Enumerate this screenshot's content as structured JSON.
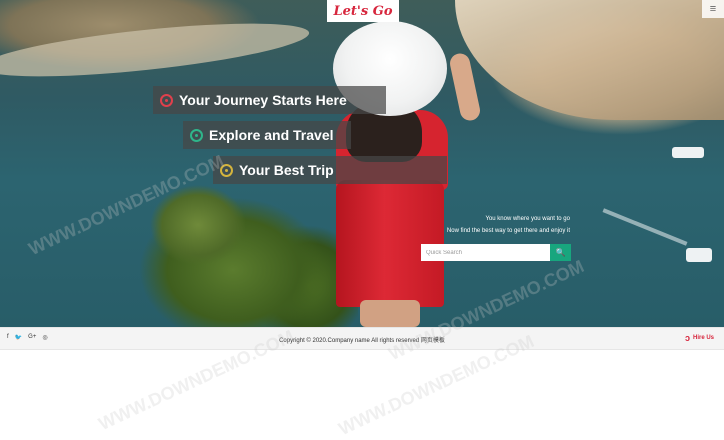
{
  "brand": {
    "logo": "Let's Go"
  },
  "header": {
    "menu_icon": "≡"
  },
  "hero": {
    "taglines": [
      {
        "text": "Your Journey Starts Here",
        "icon": "circle-dot-icon",
        "color": "#e0404c"
      },
      {
        "text": "Explore and Travel",
        "icon": "circle-dot-icon",
        "color": "#2fb58a"
      },
      {
        "text": "Your Best Trip",
        "icon": "circle-dot-icon",
        "color": "#d4b43d"
      }
    ],
    "hint_line1": "You know where you want to go",
    "hint_line2": "Now find the best way to get there and enjoy it",
    "search": {
      "placeholder": "Quick Search",
      "button_icon": "🔍",
      "button_color": "#18a67e"
    }
  },
  "footer": {
    "socials": [
      "f",
      "🐦",
      "G+",
      "◎"
    ],
    "copyright": "Copyright © 2020.Company name All rights reserved 网页模板",
    "hire": {
      "icon": "ↄ",
      "label": "Hire Us"
    }
  },
  "watermark": "WWW.DOWNDEMO.COM"
}
